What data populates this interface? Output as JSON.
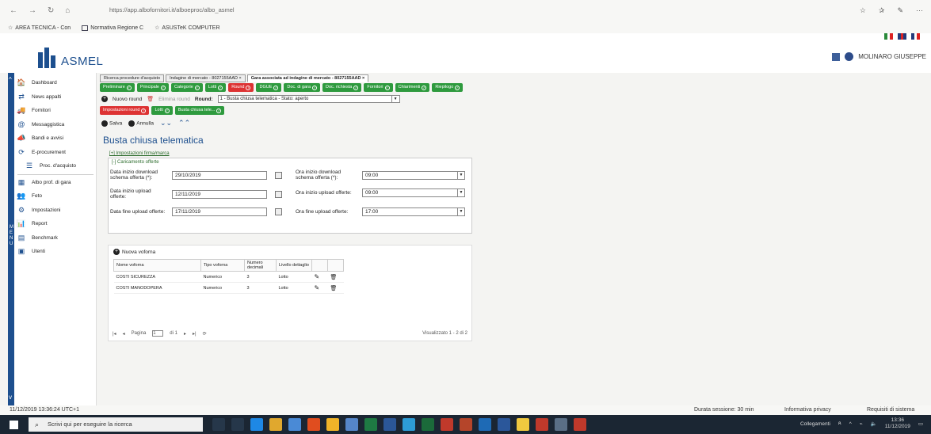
{
  "browser": {
    "url": "https://app.albofornitori.it/alboeproc/albo_asmel",
    "back": "←",
    "forward": "→",
    "refresh": "↻",
    "home": "⌂"
  },
  "bookmarks": [
    {
      "label": "AREA TECNICA - Con"
    },
    {
      "label": "Normativa Regione C"
    },
    {
      "label": "ASUSTeK COMPUTER"
    }
  ],
  "header": {
    "logo_text": "ASMEL",
    "user_name": "MOLINARO GIUSEPPE"
  },
  "sidebar": {
    "items": [
      {
        "label": "Dashboard",
        "icon": "🏠"
      },
      {
        "label": "News appalti",
        "icon": "⇄"
      },
      {
        "label": "Fornitori",
        "icon": "🚚"
      },
      {
        "label": "Messaggistica",
        "icon": "@"
      },
      {
        "label": "Bandi e avvisi",
        "icon": "📣"
      },
      {
        "label": "E-procurement",
        "icon": "⟳"
      },
      {
        "label": "Proc. d'acquisto",
        "icon": "☰"
      },
      {
        "label": "Albo prof. di gara",
        "icon": "▦"
      },
      {
        "label": "Feto",
        "icon": "👥"
      },
      {
        "label": "Impostazioni",
        "icon": "⚙"
      },
      {
        "label": "Report",
        "icon": "📊"
      },
      {
        "label": "Benchmark",
        "icon": "▤"
      },
      {
        "label": "Utenti",
        "icon": "▣"
      }
    ],
    "menu_vertical": "M E N U"
  },
  "tabs": [
    {
      "label": "Ricerca procedure d'acquisto"
    },
    {
      "label": "Indagine di mercato - 8027155AAD ×"
    },
    {
      "label": "Gara associata ad indagine di mercato - 8027155AAD ×"
    }
  ],
  "phases": [
    {
      "label": "Preliminare",
      "red": false
    },
    {
      "label": "Principale",
      "red": false
    },
    {
      "label": "Categorie",
      "red": false
    },
    {
      "label": "Lotti",
      "red": false
    },
    {
      "label": "Round",
      "red": true
    },
    {
      "label": "DGUE",
      "red": false
    },
    {
      "label": "Doc. di gara",
      "red": false
    },
    {
      "label": "Doc. richiesta",
      "red": false
    },
    {
      "label": "Fornitori",
      "red": false
    },
    {
      "label": "Chiarimenti",
      "red": false
    },
    {
      "label": "Riepilogo",
      "red": false
    }
  ],
  "round_row": {
    "new_round": "Nuovo round",
    "delete_round": "Elimina round",
    "round_label": "Round:",
    "round_value": "1 - Busta chiusa telematica - Stato: aperto"
  },
  "subchips": [
    {
      "label": "Impostazioni round",
      "red": true
    },
    {
      "label": "Lotti",
      "red": false
    },
    {
      "label": "Busta chiusa tele...",
      "red": false
    }
  ],
  "actions": {
    "save": "Salva",
    "cancel": "Annulla"
  },
  "page": {
    "title": "Busta chiusa telematica",
    "firm_section": "[+] Impostazioni firma/marca",
    "upload_section": "[-] Caricamento offerte"
  },
  "form": {
    "start_download_label": "Data inizio download schema offerta (*):",
    "start_download_value": "29/10/2019",
    "start_upload_label": "Data inizio upload offerte:",
    "start_upload_value": "12/11/2019",
    "end_upload_label": "Data fine upload offerte:",
    "end_upload_value": "17/11/2019",
    "time_download_label": "Ora inizio download schema offerta (*):",
    "time_download_value": "09:00",
    "time_upload_label": "Ora inizio upload offerte:",
    "time_upload_value": "09:00",
    "time_end_label": "Ora fine upload offerte:",
    "time_end_value": "17:00"
  },
  "grid": {
    "new_voice": "Nuova voforna",
    "columns": [
      "Nome voforna",
      "Tipo voforna",
      "Numero decimali",
      "Livello dettaglio",
      "",
      ""
    ],
    "rows": [
      {
        "name": "COSTI SICUREZZA",
        "type": "Numerico",
        "decimals": "3",
        "level": "Lotto"
      },
      {
        "name": "COSTI MANODOPERA",
        "type": "Numerico",
        "decimals": "3",
        "level": "Lotto"
      }
    ]
  },
  "pager": {
    "page_label": "Pagina",
    "page_value": "1",
    "of": "di 1",
    "display": "Visualizzato 1 - 2 di 2"
  },
  "status": {
    "datetime": "11/12/2019 13:36:24 UTC+1",
    "session": "Durata sessione: 30 min",
    "privacy": "Informativa privacy",
    "requirements": "Requisiti di sistema"
  },
  "taskbar": {
    "search_placeholder": "Scrivi qui per eseguire la ricerca",
    "links": "Collegamenti",
    "time": "13:36",
    "date": "11/12/2019"
  }
}
